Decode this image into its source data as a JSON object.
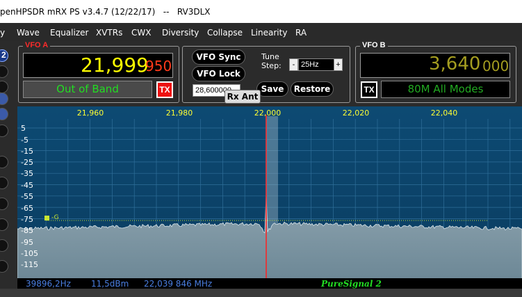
{
  "window": {
    "title": "penHPSDR mRX PS v3.4.7 (12/22/17)   --   RV3DLX"
  },
  "menu": {
    "items": [
      "y",
      "Wave",
      "Equalizer",
      "XVTRs",
      "CWX",
      "Diversity",
      "Collapse",
      "Linearity",
      "RA"
    ]
  },
  "left": {
    "badge": "2"
  },
  "vfo_a": {
    "legend": "VFO A",
    "freq_main": "21,999",
    "freq_sub": "950",
    "band_status": "Out of Band",
    "tx_label": "TX"
  },
  "vfo_b": {
    "legend": "VFO B",
    "freq_main": "3,640",
    "freq_sub": "000",
    "band_status": "80M All Modes",
    "tx_label": "TX"
  },
  "center": {
    "vfo_sync": "VFO Sync",
    "vfo_lock": "VFO Lock",
    "tune_label": "Tune",
    "step_label": "Step:",
    "step_minus": "-",
    "step_value": "25Hz",
    "step_plus": "+",
    "save": "Save",
    "restore": "Restore",
    "memory_freq": "28,600000",
    "rx_ant": "Rx Ant"
  },
  "panadapter": {
    "x_ticks": [
      "21,960",
      "21,980",
      "22,000",
      "22,020",
      "22,040"
    ],
    "y_ticks": [
      "5",
      "-5",
      "-15",
      "-25",
      "-35",
      "-45",
      "-55",
      "-65",
      "-75",
      "-85",
      "-95",
      "-105",
      "-115"
    ],
    "agc_marker": "-G",
    "colors": {
      "grid": "#2f6f9a",
      "x_labels": "#ffff33",
      "y_labels": "#ffffff",
      "spectrum": "#9aaab2",
      "cursor": "#ff2020",
      "agc_line": "#c8e632"
    }
  },
  "status": {
    "cursor_freq_offset": "39896,2Hz",
    "cursor_level": "11,5dBm",
    "cursor_freq": "22,039 846 MHz",
    "puresignal": "PureSignal 2"
  }
}
